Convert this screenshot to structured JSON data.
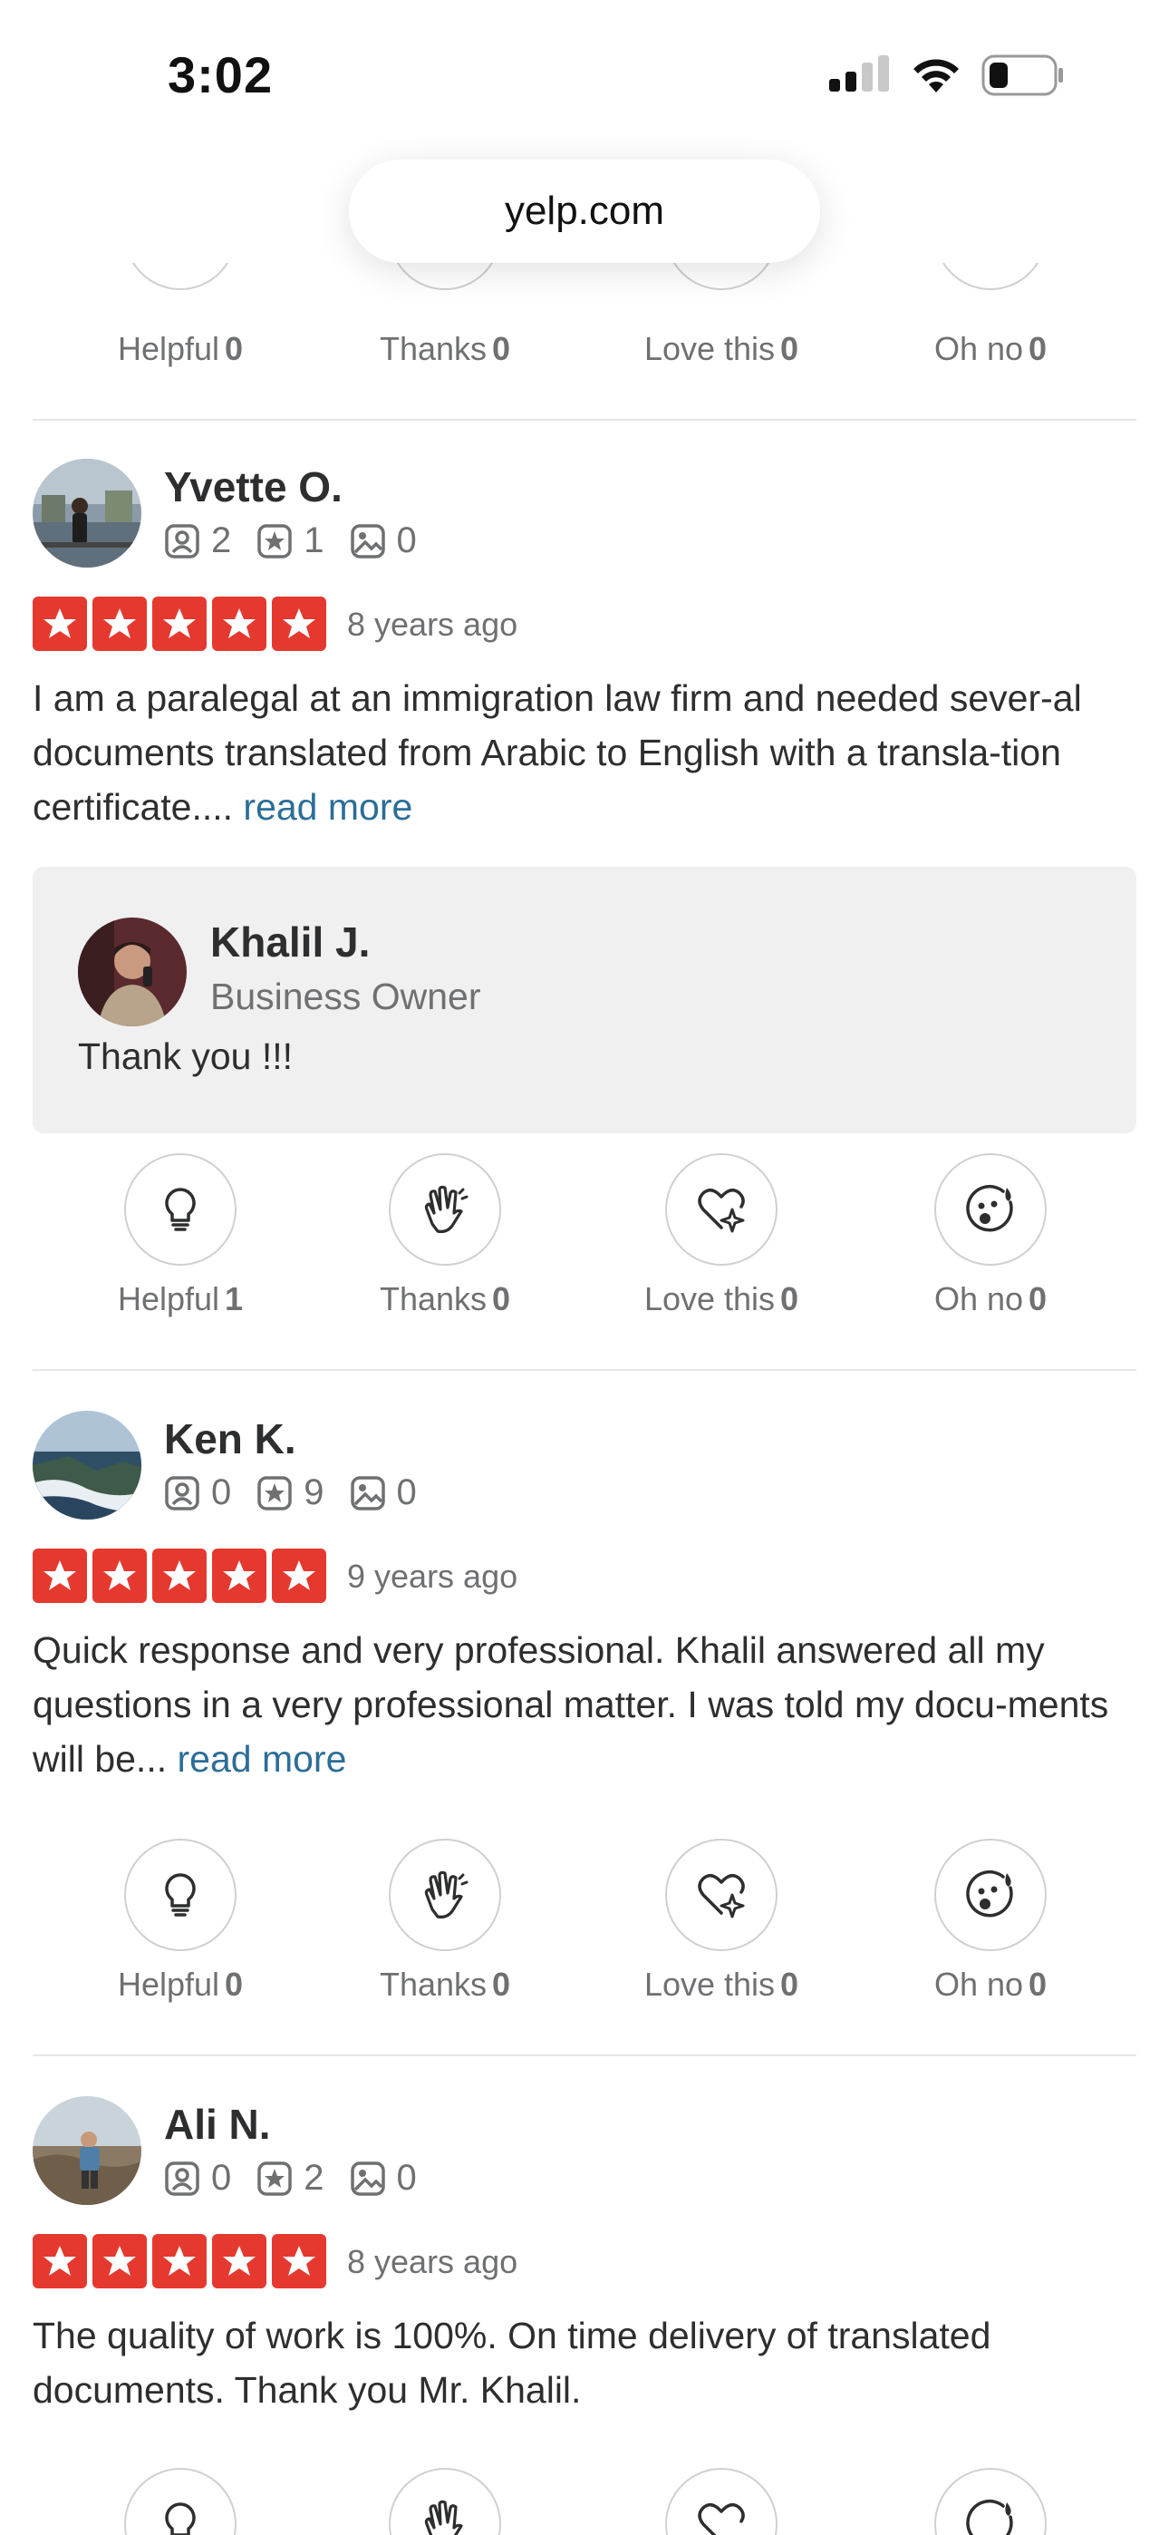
{
  "status": {
    "time": "3:02"
  },
  "browser": {
    "url": "yelp.com"
  },
  "reaction_labels": {
    "helpful": "Helpful",
    "thanks": "Thanks",
    "love": "Love this",
    "ohno": "Oh no"
  },
  "top_reactions": {
    "helpful": "0",
    "thanks": "0",
    "love": "0",
    "ohno": "0"
  },
  "reviews": [
    {
      "name": "Yvette O.",
      "friends": "2",
      "reviews_count": "1",
      "photos": "0",
      "rating": 5,
      "date": "8 years ago",
      "text": "I am a paralegal at an immigration law firm and needed sever-al documents translated from Arabic to English with a transla-tion certificate....",
      "read_more": "read more",
      "owner_reply": {
        "name": "Khalil J.",
        "role": "Business Owner",
        "message": "Thank you !!!"
      },
      "reactions": {
        "helpful": "1",
        "thanks": "0",
        "love": "0",
        "ohno": "0"
      }
    },
    {
      "name": "Ken K.",
      "friends": "0",
      "reviews_count": "9",
      "photos": "0",
      "rating": 5,
      "date": "9 years ago",
      "text": "Quick response and very professional. Khalil answered all my questions in a very professional matter. I was told my docu-ments will be...",
      "read_more": "read more",
      "reactions": {
        "helpful": "0",
        "thanks": "0",
        "love": "0",
        "ohno": "0"
      }
    },
    {
      "name": "Ali N.",
      "friends": "0",
      "reviews_count": "2",
      "photos": "0",
      "rating": 5,
      "date": "8 years ago",
      "text": "The quality of work is 100%. On time delivery of translated documents. Thank you Mr. Khalil."
    }
  ],
  "colors": {
    "star_red": "#e5392f",
    "link_blue": "#2b6e98",
    "owner_bg": "#f0f0f0"
  }
}
